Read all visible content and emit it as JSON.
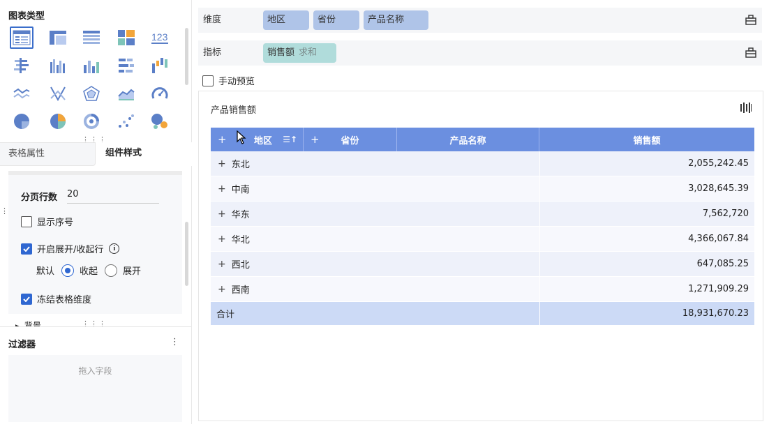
{
  "left": {
    "chart_types_title": "图表类型",
    "chart_icons": [
      "table-icon",
      "cross-table-icon",
      "detail-table-icon",
      "kpi-grid-icon",
      "number-123-icon",
      "grouped-bar-h-icon",
      "grouped-column-icon",
      "column-icon",
      "bar-h-icon",
      "waterfall-icon",
      "line-icon",
      "parallel-lines-icon",
      "radar-icon",
      "area-icon",
      "gauge-icon",
      "pie-icon",
      "multi-pie-icon",
      "ring-icon",
      "scatter-icon",
      "bubble-icon"
    ],
    "tabs": {
      "table_props": "表格属性",
      "component_style": "组件样式"
    },
    "props": {
      "page_rows_label": "分页行数",
      "page_rows_value": "20",
      "show_index_label": "显示序号",
      "show_index_checked": false,
      "expand_collapse_label": "开启展开/收起行",
      "expand_collapse_checked": true,
      "default_label": "默认",
      "collapse_label": "收起",
      "expand_label": "展开",
      "freeze_label": "冻结表格维度",
      "freeze_checked": true,
      "partial_next_label": "背景"
    },
    "filter": {
      "title": "过滤器",
      "more": "⋮",
      "drop_hint": "拖入字段"
    }
  },
  "right": {
    "dimension": {
      "label": "维度",
      "pills": [
        "地区",
        "省份",
        "产品名称"
      ]
    },
    "measure": {
      "label": "指标",
      "pills": [
        {
          "name": "销售额",
          "agg": "求和"
        }
      ]
    },
    "manual_preview": {
      "label": "手动预览",
      "checked": false
    },
    "widget": {
      "title": "产品销售额",
      "headers": {
        "region": "地区",
        "province": "省份",
        "product": "产品名称",
        "sales": "销售额"
      },
      "rows": [
        {
          "name": "东北",
          "value": "2,055,242.45"
        },
        {
          "name": "中南",
          "value": "3,028,645.39"
        },
        {
          "name": "华东",
          "value": "7,562,720"
        },
        {
          "name": "华北",
          "value": "4,366,067.84"
        },
        {
          "name": "西北",
          "value": "647,085.25"
        },
        {
          "name": "西南",
          "value": "1,271,909.29"
        }
      ],
      "total": {
        "name": "合计",
        "value": "18,931,670.23"
      }
    }
  },
  "colors": {
    "accent": "#2f67d1",
    "header": "#6b8fe0",
    "dim_pill": "#afc4e8",
    "measure_pill": "#b0dcdb"
  }
}
